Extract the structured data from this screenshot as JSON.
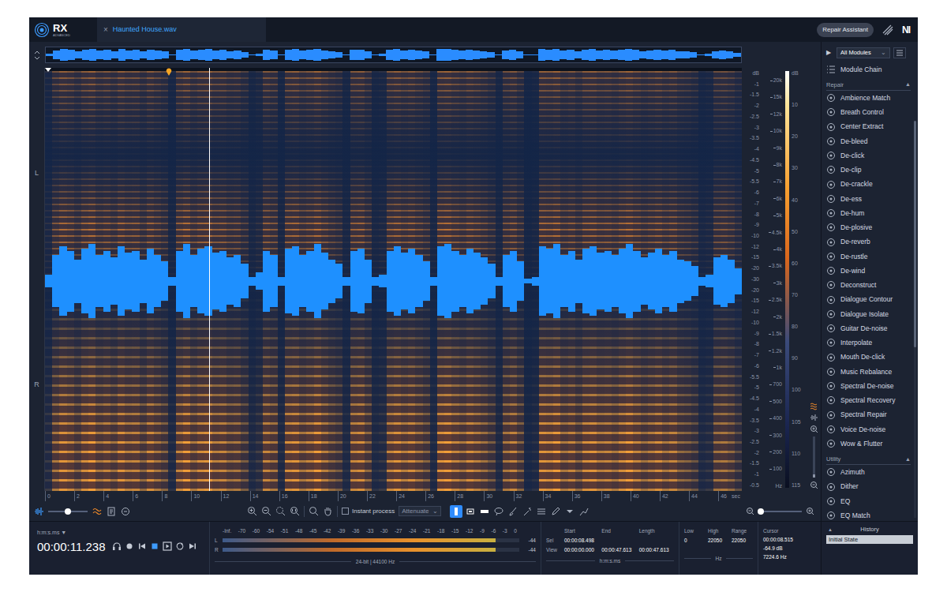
{
  "app": {
    "logo": "RX",
    "edition": "ADVANCED"
  },
  "tab": {
    "close": "×",
    "label": "Haunted House.wav",
    "selected": true
  },
  "header": {
    "repair_assistant": "Repair Assistant",
    "brand": "NI"
  },
  "waveform": {
    "levels": [
      0.15,
      0.6,
      0.8,
      0.7,
      0.5,
      0.75,
      0.85,
      0.6,
      0.7,
      0.55,
      0.8,
      0.65,
      0.7,
      0.5,
      0.75,
      0.6,
      0.45,
      0.1,
      0.7,
      0.85,
      0.6,
      0.75,
      0.8,
      0.65,
      0.7,
      0.55,
      0.6,
      0.4,
      0.1,
      0.2,
      0.7,
      0.6,
      0.1,
      0.75,
      0.8,
      0.6,
      0.7,
      0.85,
      0.65,
      0.5,
      0.4,
      0.1,
      0.7,
      0.75,
      0.5,
      0.1,
      0.15,
      0.7,
      0.8,
      0.65,
      0.75,
      0.6,
      0.45,
      0.1,
      0.8,
      0.85,
      0.7,
      0.6,
      0.75,
      0.65,
      0.55,
      0.4,
      0.1,
      0.6,
      0.7,
      0.45,
      0.05,
      0.1,
      0.8,
      0.75,
      0.85,
      0.6,
      0.7,
      0.5,
      0.75,
      0.8,
      0.65,
      0.7,
      0.6,
      0.75,
      0.85,
      0.7,
      0.55,
      0.65,
      0.75,
      0.6,
      0.7,
      0.5,
      0.45,
      0.35,
      0.1,
      0.15,
      0.55,
      0.6,
      0.5,
      0.3
    ]
  },
  "channels": [
    {
      "label": "L"
    },
    {
      "label": "R"
    }
  ],
  "markers": {
    "playhead_level": 0.236,
    "selection_start_level": 0.178
  },
  "db_scale": {
    "unit": "dB",
    "ticks": [
      "-1",
      "-1.5",
      "-2",
      "-2.5",
      "-3",
      "-3.5",
      "-4",
      "-4.5",
      "-5",
      "-5.5",
      "-6",
      "-7",
      "-8",
      "-9",
      "-10",
      "-12",
      "-15",
      "-20",
      "-30",
      "-20",
      "-15",
      "-12",
      "-10",
      "-9",
      "-8",
      "-7",
      "-6",
      "-5.5",
      "-5",
      "-4.5",
      "-4",
      "-3.5",
      "-3",
      "-2.5",
      "-2",
      "-1.5",
      "-1",
      "-0.5"
    ]
  },
  "hz_scale": {
    "unit": "Hz",
    "ticks": [
      "20k",
      "15k",
      "12k",
      "10k",
      "9k",
      "8k",
      "7k",
      "6k",
      "5k",
      "4.5k",
      "4k",
      "3.5k",
      "3k",
      "2.5k",
      "2k",
      "1.5k",
      "1.2k",
      "1k",
      "700",
      "500",
      "400",
      "300",
      "200",
      "100"
    ]
  },
  "color_scale": {
    "unit": "dB",
    "ticks": [
      "10",
      "20",
      "30",
      "40",
      "50",
      "60",
      "70",
      "80",
      "90",
      "100",
      "105",
      "110",
      "115"
    ]
  },
  "vertical_zoom": {
    "level": 0.08
  },
  "time_axis": {
    "ticks": [
      "0",
      "2",
      "4",
      "6",
      "8",
      "10",
      "12",
      "14",
      "16",
      "18",
      "20",
      "22",
      "24",
      "26",
      "28",
      "30",
      "32",
      "34",
      "36",
      "38",
      "40",
      "42",
      "44",
      "46"
    ],
    "unit": "sec"
  },
  "toolbar": {
    "display_blend_level": 0.5,
    "instant_process": {
      "label": "Instant process",
      "checked": false
    },
    "mode": {
      "value": "Attenuate",
      "arrow": "⌄"
    },
    "tools": [
      {
        "selected": true
      },
      {
        "selected": false
      },
      {
        "selected": false
      },
      {
        "selected": false
      },
      {
        "selected": false
      },
      {
        "selected": false
      },
      {
        "selected": false
      },
      {
        "selected": false
      },
      {
        "selected": false
      },
      {
        "selected": false
      }
    ],
    "zoom_level": 0.05
  },
  "transport": {
    "time_format": "h:m:s.ms ▼",
    "time": "00:00:11.238",
    "buttons": [
      {
        "selected": false
      },
      {
        "selected": false
      },
      {
        "selected": false
      },
      {
        "selected": true
      },
      {
        "selected": false
      },
      {
        "selected": false
      },
      {
        "selected": false
      }
    ]
  },
  "meters": {
    "scale": [
      "-Inf.",
      "-70",
      "-60",
      "-54",
      "-51",
      "-48",
      "-45",
      "-42",
      "-39",
      "-36",
      "-33",
      "-30",
      "-27",
      "-24",
      "-21",
      "-18",
      "-15",
      "-12",
      "-9",
      "-6",
      "-3",
      "0"
    ],
    "channels": [
      {
        "label": "L",
        "level": 0.92,
        "reading": "-44"
      },
      {
        "label": "R",
        "level": 0.92,
        "reading": "-44"
      }
    ],
    "format": "24-bit | 44100 Hz"
  },
  "selection": {
    "columns": [
      "Start",
      "End",
      "Length"
    ],
    "rows": [
      {
        "label": "Sel",
        "values": [
          "00:00:08.498"
        ]
      },
      {
        "label": "View",
        "values": [
          "00:00:00.000",
          "00:00:47.613",
          "00:00:47.613"
        ]
      }
    ],
    "unit": "h:m:s.ms"
  },
  "frequency": {
    "columns": [
      "Low",
      "High",
      "Range"
    ],
    "values": [
      "0",
      "22050",
      "22050"
    ],
    "unit": "Hz"
  },
  "cursor": {
    "label": "Cursor",
    "time": "00:00:08.515",
    "level": "-64.9 dB",
    "frequency": "7224.6 Hz"
  },
  "modules": {
    "play": "▶",
    "filter": "All Modules",
    "filter_arrow": "⌄",
    "module_chain": "Module Chain",
    "scrollbar_level": 0.57,
    "sections": [
      {
        "title": "Repair",
        "toggle": "▲",
        "items": [
          "Ambience Match",
          "Breath Control",
          "Center Extract",
          "De-bleed",
          "De-click",
          "De-clip",
          "De-crackle",
          "De-ess",
          "De-hum",
          "De-plosive",
          "De-reverb",
          "De-rustle",
          "De-wind",
          "Deconstruct",
          "Dialogue Contour",
          "Dialogue Isolate",
          "Guitar De-noise",
          "Interpolate",
          "Mouth De-click",
          "Music Rebalance",
          "Spectral De-noise",
          "Spectral Recovery",
          "Spectral Repair",
          "Voice De-noise",
          "Wow & Flutter"
        ]
      },
      {
        "title": "Utility",
        "toggle": "▲",
        "items": [
          "Azimuth",
          "Dither",
          "EQ",
          "EQ Match"
        ]
      }
    ]
  },
  "history": {
    "toggle": "▲",
    "title": "History",
    "items": [
      {
        "label": "Initial State",
        "selected": true
      }
    ]
  }
}
